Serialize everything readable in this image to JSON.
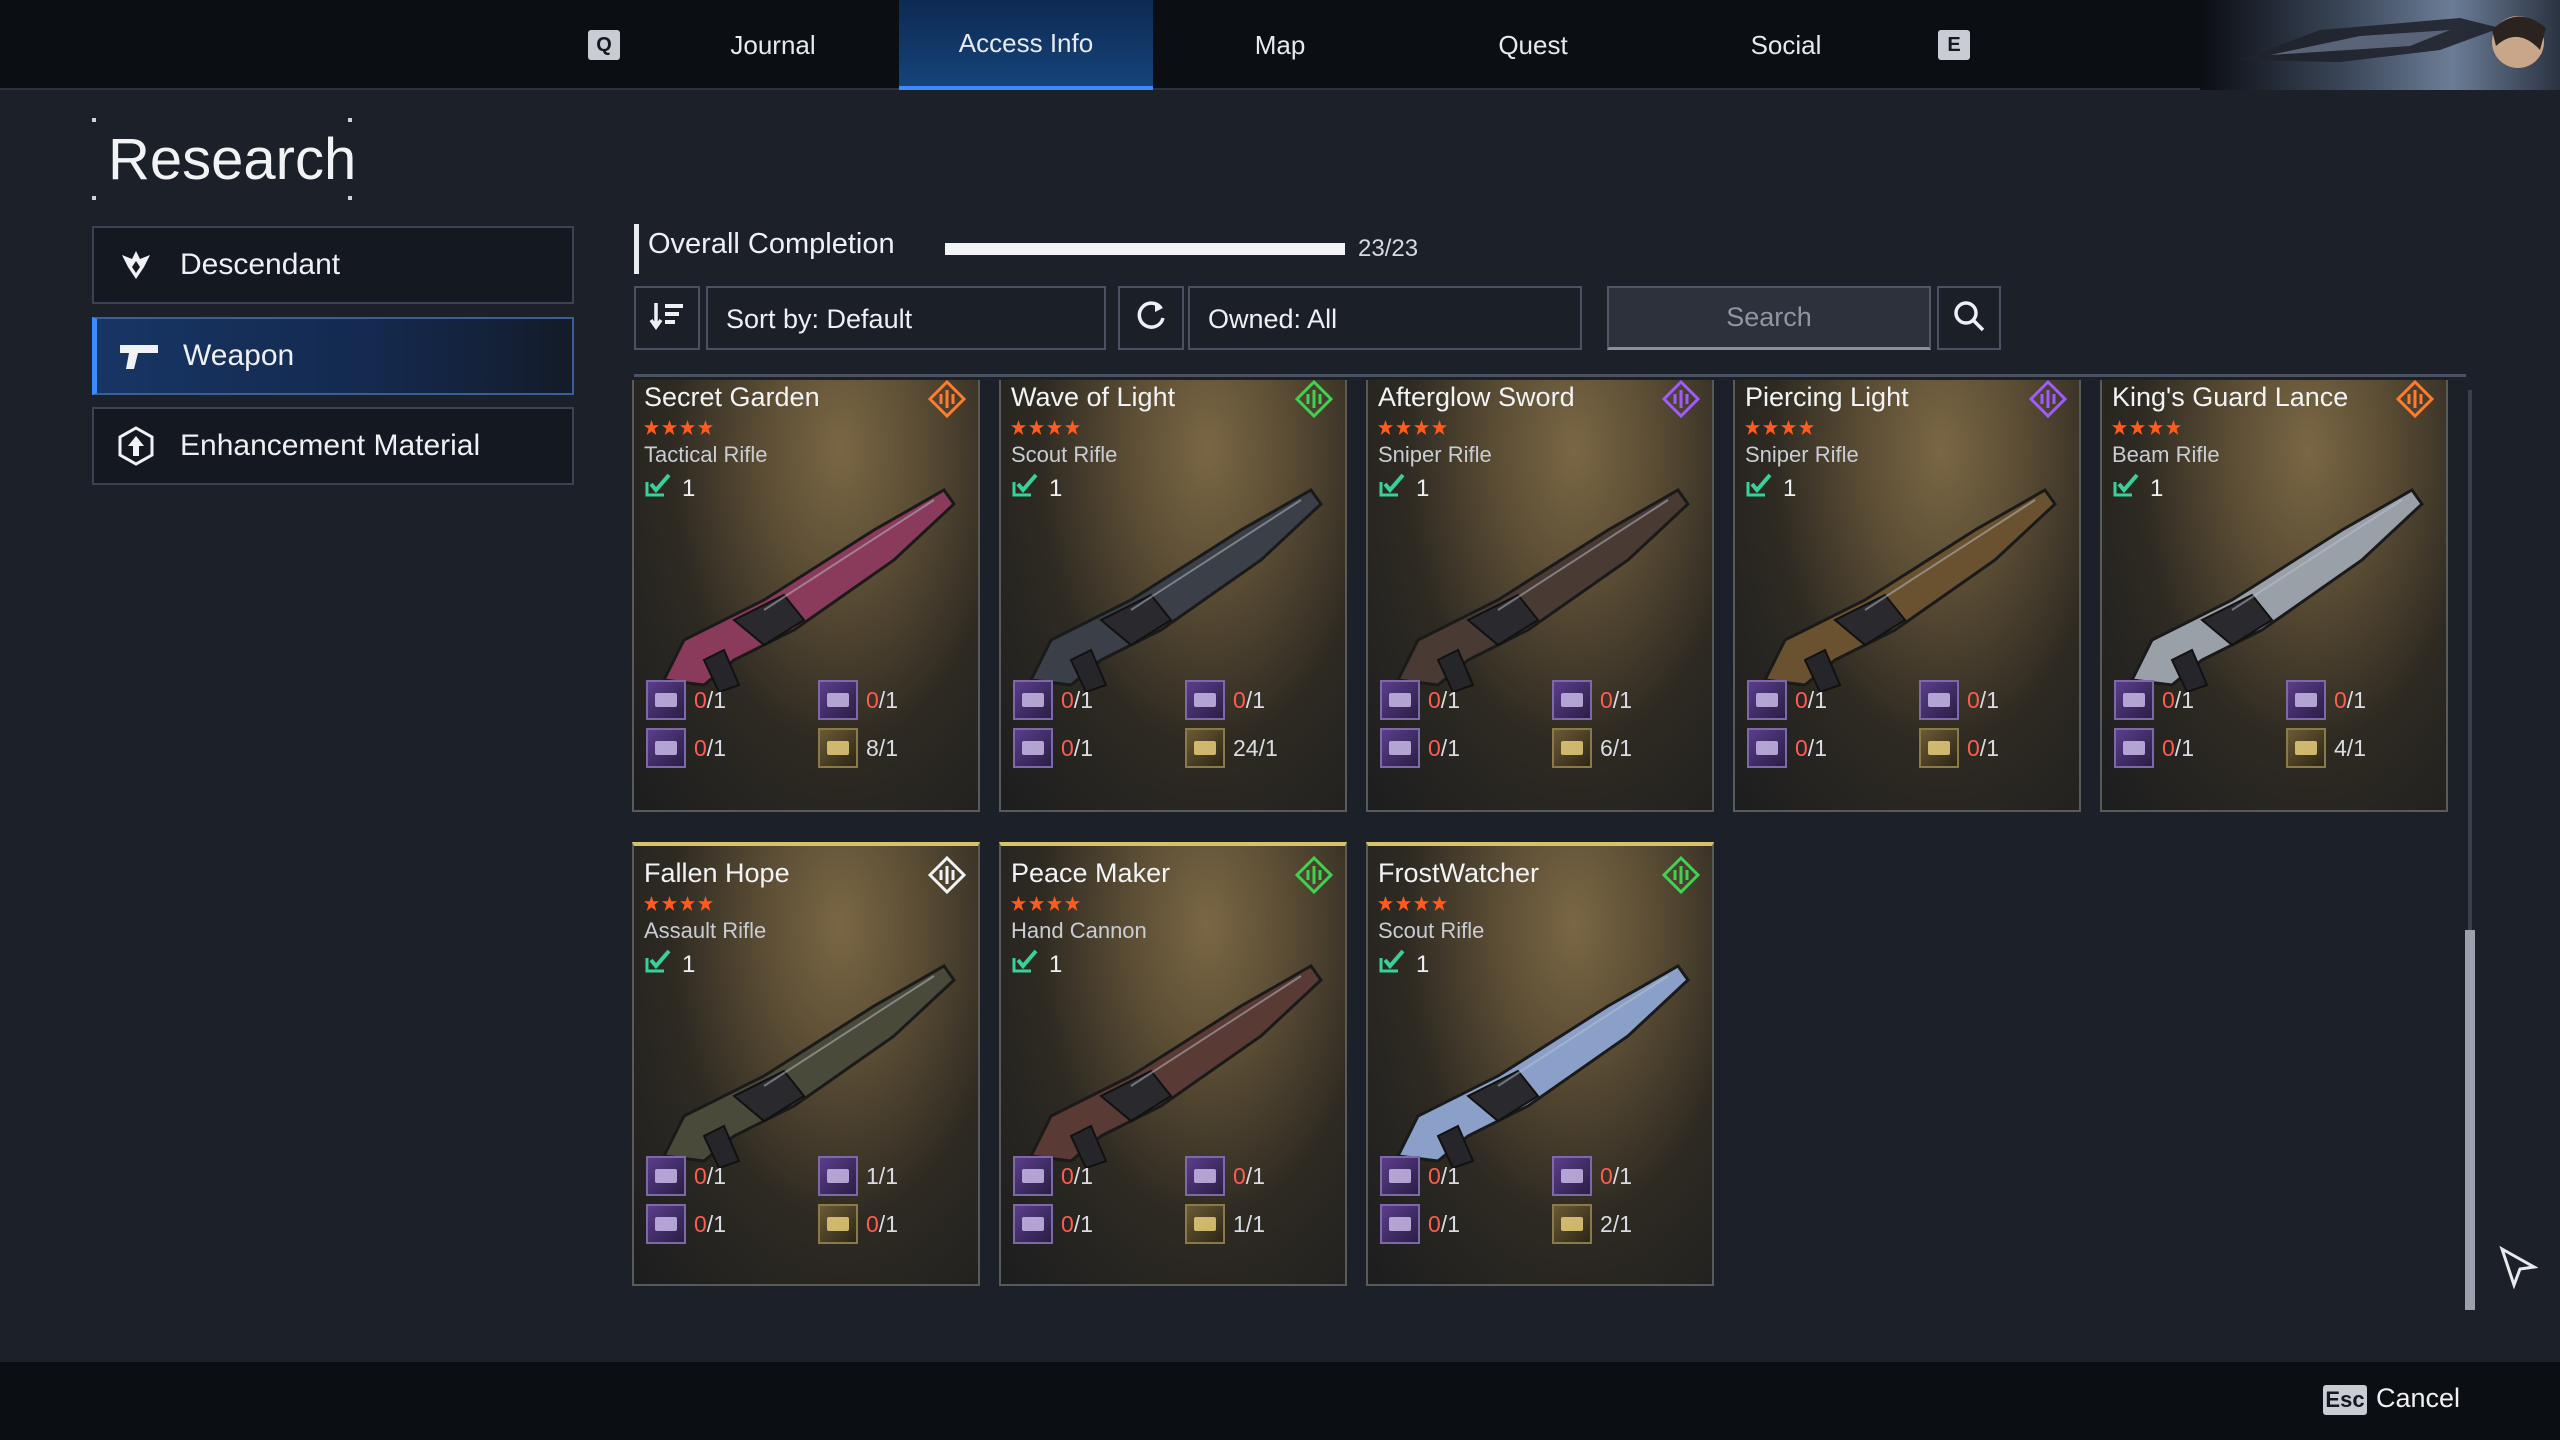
{
  "nav": {
    "left_key": "Q",
    "right_key": "E",
    "tabs": [
      "Journal",
      "Access Info",
      "Map",
      "Quest",
      "Social"
    ],
    "active_tab": "Access Info"
  },
  "page": {
    "title": "Research"
  },
  "sidebar": {
    "items": [
      {
        "label": "Descendant",
        "icon": "descendant-icon",
        "active": false
      },
      {
        "label": "Weapon",
        "icon": "pistol-icon",
        "active": true
      },
      {
        "label": "Enhancement Material",
        "icon": "hexagon-arrow-icon",
        "active": false
      }
    ]
  },
  "completion": {
    "label": "Overall Completion",
    "count": "23/23",
    "progress": 1.0
  },
  "controls": {
    "sort_label": "Sort by: Default",
    "owned_label": "Owned: All",
    "search_placeholder": "Search"
  },
  "cards": [
    {
      "name": "Secret Garden",
      "stars": 4,
      "type": "Tactical Rifle",
      "owned": "1",
      "badge": "orange",
      "mats": [
        {
          "have": "0",
          "need": "1"
        },
        {
          "have": "0",
          "need": "1"
        },
        {
          "have": "0",
          "need": "1"
        },
        {
          "have": "8",
          "need": "1"
        }
      ]
    },
    {
      "name": "Wave of Light",
      "stars": 4,
      "type": "Scout Rifle",
      "owned": "1",
      "badge": "green",
      "mats": [
        {
          "have": "0",
          "need": "1"
        },
        {
          "have": "0",
          "need": "1"
        },
        {
          "have": "0",
          "need": "1"
        },
        {
          "have": "24",
          "need": "1"
        }
      ]
    },
    {
      "name": "Afterglow Sword",
      "stars": 4,
      "type": "Sniper Rifle",
      "owned": "1",
      "badge": "purple",
      "mats": [
        {
          "have": "0",
          "need": "1"
        },
        {
          "have": "0",
          "need": "1"
        },
        {
          "have": "0",
          "need": "1"
        },
        {
          "have": "6",
          "need": "1"
        }
      ]
    },
    {
      "name": "Piercing Light",
      "stars": 4,
      "type": "Sniper Rifle",
      "owned": "1",
      "badge": "purple",
      "mats": [
        {
          "have": "0",
          "need": "1"
        },
        {
          "have": "0",
          "need": "1"
        },
        {
          "have": "0",
          "need": "1"
        },
        {
          "have": "0",
          "need": "1"
        }
      ]
    },
    {
      "name": "King's Guard Lance",
      "stars": 4,
      "type": "Beam Rifle",
      "owned": "1",
      "badge": "orange",
      "mats": [
        {
          "have": "0",
          "need": "1"
        },
        {
          "have": "0",
          "need": "1"
        },
        {
          "have": "0",
          "need": "1"
        },
        {
          "have": "4",
          "need": "1"
        }
      ]
    },
    {
      "name": "Fallen Hope",
      "stars": 4,
      "type": "Assault Rifle",
      "owned": "1",
      "badge": "white",
      "mats": [
        {
          "have": "0",
          "need": "1"
        },
        {
          "have": "1",
          "need": "1"
        },
        {
          "have": "0",
          "need": "1"
        },
        {
          "have": "0",
          "need": "1"
        }
      ]
    },
    {
      "name": "Peace Maker",
      "stars": 4,
      "type": "Hand Cannon",
      "owned": "1",
      "badge": "green",
      "mats": [
        {
          "have": "0",
          "need": "1"
        },
        {
          "have": "0",
          "need": "1"
        },
        {
          "have": "0",
          "need": "1"
        },
        {
          "have": "1",
          "need": "1"
        }
      ]
    },
    {
      "name": "FrostWatcher",
      "stars": 4,
      "type": "Scout Rifle",
      "owned": "1",
      "badge": "green",
      "mats": [
        {
          "have": "0",
          "need": "1"
        },
        {
          "have": "0",
          "need": "1"
        },
        {
          "have": "0",
          "need": "1"
        },
        {
          "have": "2",
          "need": "1"
        }
      ]
    }
  ],
  "footer": {
    "key": "Esc",
    "label": "Cancel"
  },
  "colors": {
    "accent": "#3d8bff",
    "zero_count": "#ff5b4f",
    "star": "#ff5a1f"
  }
}
